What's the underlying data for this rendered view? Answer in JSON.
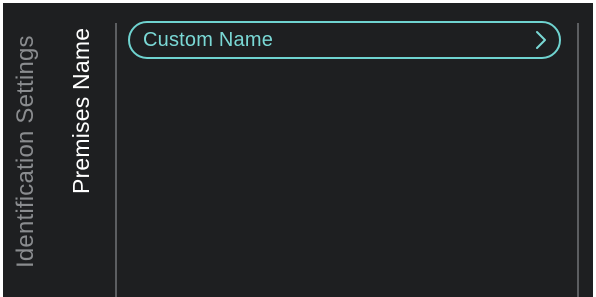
{
  "breadcrumb": {
    "parent": "Identification Settings",
    "current": "Premises Name"
  },
  "menu": {
    "items": [
      {
        "label": "Custom Name",
        "icon": "chevron-right-icon"
      }
    ]
  },
  "colors": {
    "background": "#1e1f21",
    "accent": "#6fd3d0",
    "muted_text": "#8a8c8f",
    "primary_text": "#ffffff",
    "divider": "#5c5e61"
  }
}
